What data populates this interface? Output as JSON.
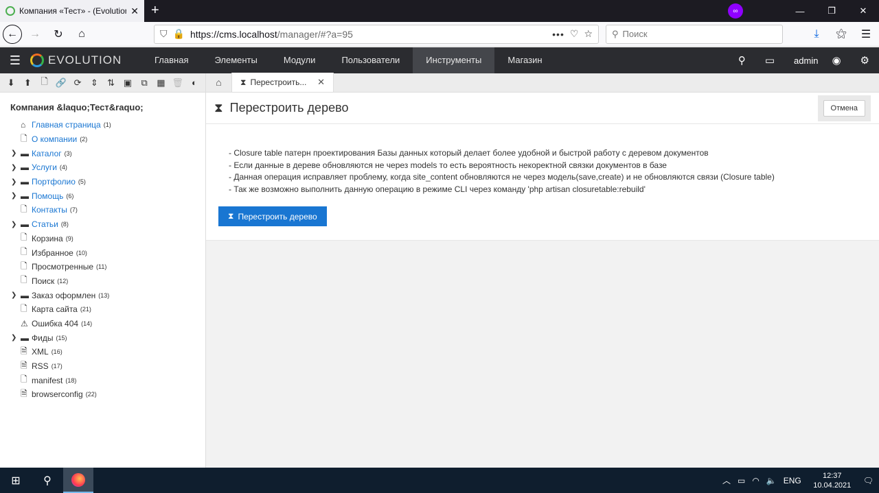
{
  "browser": {
    "tab_title": "Компания «Тест» - (Evolution",
    "url_host": "https://cms.localhost",
    "url_path": "/manager/#?a=95",
    "search_placeholder": "Поиск"
  },
  "appbar": {
    "logo": "EVOLUTION",
    "menu": [
      "Главная",
      "Элементы",
      "Модули",
      "Пользователи",
      "Инструменты",
      "Магазин"
    ],
    "active_index": 4,
    "user": "admin"
  },
  "tree": {
    "site_name": "Компания &laquo;Тест&raquo;",
    "items": [
      {
        "label": "Главная страница",
        "id": "(1)",
        "icon": "home-icon",
        "folder": false,
        "link": true
      },
      {
        "label": "О компании",
        "id": "(2)",
        "icon": "file-icon",
        "folder": false,
        "link": true
      },
      {
        "label": "Каталог",
        "id": "(3)",
        "icon": "folder-icon",
        "folder": true,
        "link": true
      },
      {
        "label": "Услуги",
        "id": "(4)",
        "icon": "folder-icon",
        "folder": true,
        "link": true
      },
      {
        "label": "Портфолио",
        "id": "(5)",
        "icon": "folder-icon",
        "folder": true,
        "link": true
      },
      {
        "label": "Помощь",
        "id": "(6)",
        "icon": "folder-icon",
        "folder": true,
        "link": true
      },
      {
        "label": "Контакты",
        "id": "(7)",
        "icon": "file-icon",
        "folder": false,
        "link": true
      },
      {
        "label": "Статьи",
        "id": "(8)",
        "icon": "folder-icon",
        "folder": true,
        "link": true
      },
      {
        "label": "Корзина",
        "id": "(9)",
        "icon": "file-icon",
        "folder": false,
        "link": false
      },
      {
        "label": "Избранное",
        "id": "(10)",
        "icon": "file-icon",
        "folder": false,
        "link": false
      },
      {
        "label": "Просмотренные",
        "id": "(11)",
        "icon": "file-icon",
        "folder": false,
        "link": false
      },
      {
        "label": "Поиск",
        "id": "(12)",
        "icon": "file-icon",
        "folder": false,
        "link": false
      },
      {
        "label": "Заказ оформлен",
        "id": "(13)",
        "icon": "folder-icon",
        "folder": true,
        "link": false
      },
      {
        "label": "Карта сайта",
        "id": "(21)",
        "icon": "file-icon",
        "folder": false,
        "link": false
      },
      {
        "label": "Ошибка 404",
        "id": "(14)",
        "icon": "warning-icon",
        "folder": false,
        "link": false
      },
      {
        "label": "Фиды",
        "id": "(15)",
        "icon": "folder-icon",
        "folder": true,
        "link": false
      },
      {
        "label": "XML",
        "id": "(16)",
        "icon": "code-file-icon",
        "folder": false,
        "link": false
      },
      {
        "label": "RSS",
        "id": "(17)",
        "icon": "code-file-icon",
        "folder": false,
        "link": false
      },
      {
        "label": "manifest",
        "id": "(18)",
        "icon": "file-icon",
        "folder": false,
        "link": false
      },
      {
        "label": "browserconfig",
        "id": "(22)",
        "icon": "code-file-icon",
        "folder": false,
        "link": false
      }
    ]
  },
  "main": {
    "tab_label": "Перестроить...",
    "title": "Перестроить дерево",
    "cancel_label": "Отмена",
    "lines": [
      "- Closure table патерн проектирования Базы данных который делает более удобной и быстрой работу с деревом документов",
      "- Если данные в дереве обновляются не через models то есть вероятность некоректной связки документов в базе",
      "- Данная операция исправляет проблему, когда site_content обновляются не через модель(save,create) и не обновляются связи (Closure table)",
      "- Так же возможно выполнить данную операцию в режиме CLI через команду 'php artisan closuretable:rebuild'"
    ],
    "rebuild_label": "Перестроить дерево"
  },
  "taskbar": {
    "lang": "ENG",
    "time": "12:37",
    "date": "10.04.2021"
  }
}
